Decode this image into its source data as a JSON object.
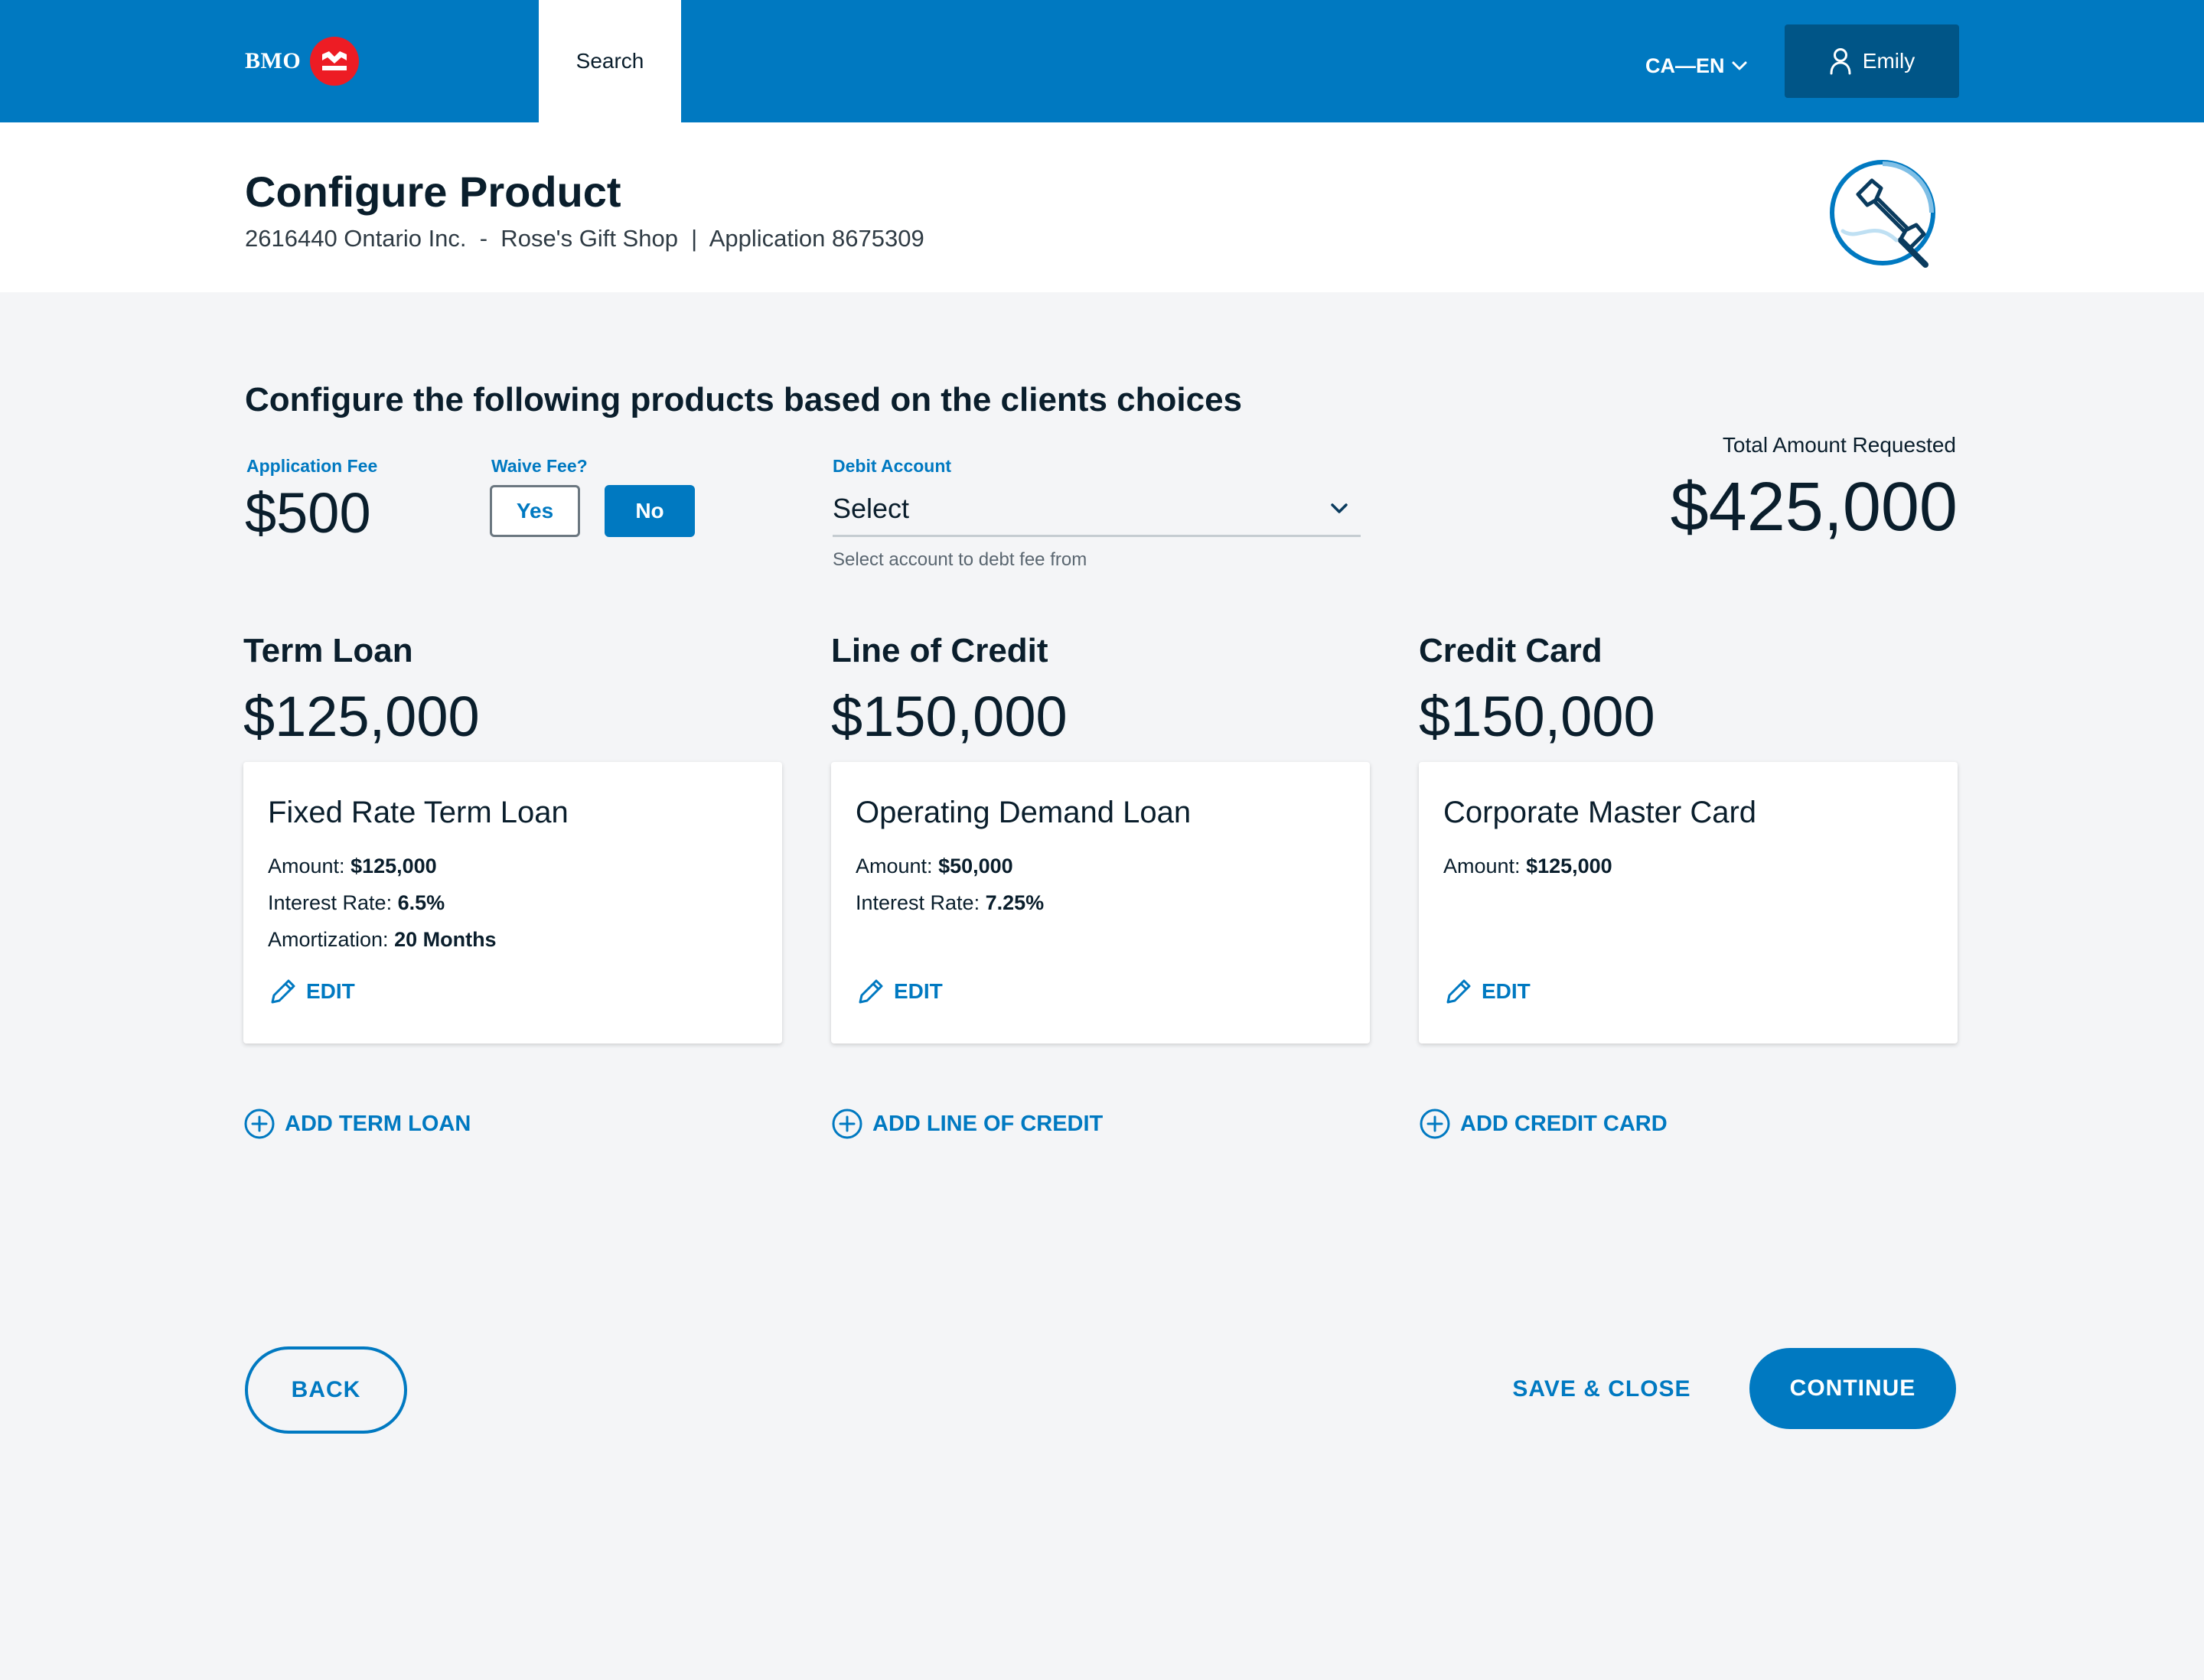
{
  "topbar": {
    "logo_text": "BMO",
    "search_tab": "Search",
    "language": "CA—EN",
    "user_name": "Emily"
  },
  "header": {
    "title": "Configure Product",
    "subtitle": "2616440 Ontario Inc.  -  Rose's Gift Shop  |  Application 8675309",
    "icon": "wrench-gear-icon"
  },
  "config": {
    "section_title": "Configure the following products based on the clients choices",
    "application_fee_label": "Application Fee",
    "application_fee_value": "$500",
    "waive_fee_label": "Waive Fee?",
    "waive_yes": "Yes",
    "waive_no": "No",
    "waive_selected": "No",
    "debit_account_label": "Debit Account",
    "debit_account_value": "Select",
    "debit_account_helper": "Select account to debt fee from",
    "total_label": "Total Amount Requested",
    "total_value": "$425,000"
  },
  "products": [
    {
      "title": "Term Loan",
      "amount": "$125,000",
      "card": {
        "name": "Fixed Rate Term Loan",
        "lines": [
          {
            "label": "Amount: ",
            "value": "$125,000"
          },
          {
            "label": "Interest Rate: ",
            "value": "6.5%"
          },
          {
            "label": "Amortization: ",
            "value": "20 Months"
          }
        ],
        "edit_label": "EDIT"
      },
      "add_label": "ADD TERM LOAN"
    },
    {
      "title": "Line of Credit",
      "amount": "$150,000",
      "card": {
        "name": "Operating Demand Loan",
        "lines": [
          {
            "label": "Amount: ",
            "value": "$50,000"
          },
          {
            "label": "Interest Rate: ",
            "value": "7.25%"
          }
        ],
        "edit_label": "EDIT"
      },
      "add_label": "ADD LINE OF CREDIT"
    },
    {
      "title": "Credit Card",
      "amount": "$150,000",
      "card": {
        "name": "Corporate Master Card",
        "lines": [
          {
            "label": "Amount: ",
            "value": "$125,000"
          }
        ],
        "edit_label": "EDIT"
      },
      "add_label": "ADD CREDIT CARD"
    }
  ],
  "footer": {
    "back_label": "BACK",
    "save_label": "SAVE & CLOSE",
    "continue_label": "CONTINUE"
  },
  "colors": {
    "brand_blue": "#0079c1",
    "dark_blue": "#005587",
    "logo_red": "#ed1c24",
    "background": "#f4f5f7"
  }
}
